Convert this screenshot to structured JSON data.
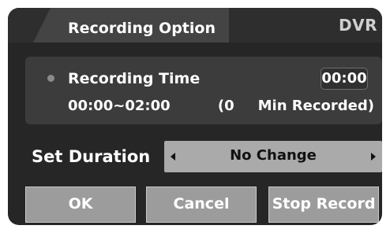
{
  "dialog": {
    "title": "Recording Option",
    "brand": "DVR"
  },
  "recording": {
    "label": "Recording Time",
    "current_time": "00:00",
    "range": "00:00~02:00",
    "recorded_open": "(0",
    "recorded_close": "Min Recorded)"
  },
  "duration": {
    "label": "Set Duration",
    "value": "No Change"
  },
  "buttons": {
    "ok": "OK",
    "cancel": "Cancel",
    "stop": "Stop Record"
  }
}
